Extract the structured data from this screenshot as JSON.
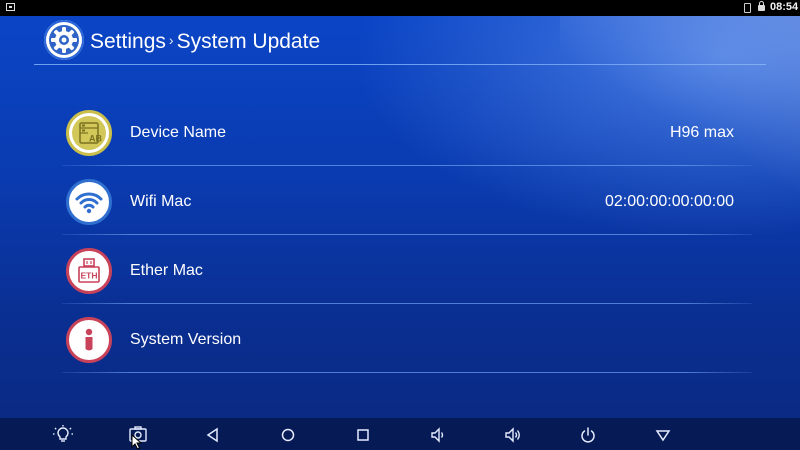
{
  "status_bar": {
    "time": "08:54"
  },
  "header": {
    "title": "Settings",
    "separator": "›",
    "subtitle": "System Update"
  },
  "rows": [
    {
      "label": "Device Name",
      "value": "H96 max",
      "icon": "device-name-icon",
      "icon_text": "AB"
    },
    {
      "label": "Wifi Mac",
      "value": "02:00:00:00:00:00",
      "icon": "wifi-icon"
    },
    {
      "label": "Ether Mac",
      "value": "",
      "icon": "ethernet-icon",
      "icon_text": "ETH"
    },
    {
      "label": "System Version",
      "value": "",
      "icon": "info-icon"
    }
  ],
  "colors": {
    "background_top": "#0b45c6",
    "background_bottom": "#0a2a84",
    "divider": "#6ea0f0",
    "navbar": "#061a56",
    "device_icon": "#c9bf4a",
    "wifi_icon": "#2f6fd0",
    "ethernet_icon": "#c8435a",
    "info_icon": "#c8435a"
  },
  "nav_bar": {
    "buttons": [
      "brightness-icon",
      "screenshot-icon",
      "back-icon",
      "home-icon",
      "recents-icon",
      "volume-down-icon",
      "volume-up-icon",
      "power-icon",
      "menu-down-icon"
    ]
  }
}
